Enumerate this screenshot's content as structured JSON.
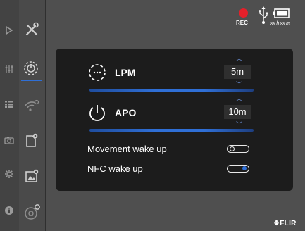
{
  "status": {
    "rec_label": "REC",
    "battery_label": "xx h xx m",
    "rec_color": "#e3202a",
    "icons": [
      "rec-dot",
      "usb-icon",
      "battery-icon"
    ]
  },
  "sidebar": {
    "outer_icons": [
      "play-icon",
      "sliders-icon",
      "grid-icon",
      "camera-icon",
      "gear-icon",
      "info-icon"
    ],
    "inner_icons": [
      "tools-icon",
      "power-timer-icon",
      "wifi-gear-icon",
      "file-gear-icon",
      "image-gear-icon",
      "settings-cog-icon"
    ],
    "selected": "power-timer-icon"
  },
  "panel": {
    "lpm": {
      "label": "LPM",
      "value": "5m",
      "icon": "timer-dots-icon"
    },
    "apo": {
      "label": "APO",
      "value": "10m",
      "icon": "power-icon"
    },
    "toggles": [
      {
        "label": "Movement wake up",
        "state": "off"
      },
      {
        "label": "NFC wake up",
        "state": "on"
      }
    ]
  },
  "brand": {
    "logo_text": "❖FLIR"
  },
  "accent_color": "#2f6fd6"
}
